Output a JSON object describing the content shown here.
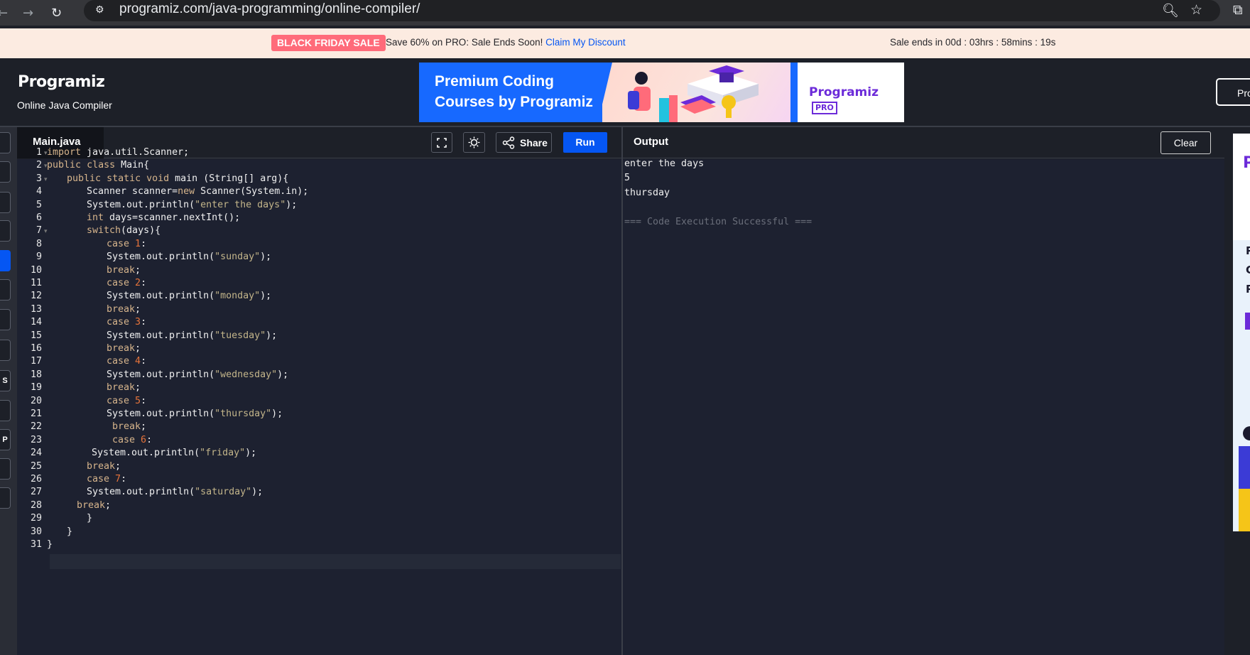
{
  "browser": {
    "url": "programiz.com/java-programming/online-compiler/"
  },
  "promo": {
    "badge": "BLACK FRIDAY SALE",
    "text": "Save 60% on PRO: Sale Ends Soon!",
    "link": "Claim My Discount",
    "timer": "Sale ends in 00d : 03hrs : 58mins : 19s"
  },
  "header": {
    "logo": "Programiz",
    "subtitle": "Online Java Compiler",
    "right_button": "Progr"
  },
  "ad": {
    "title": "Premium Coding Courses by Programiz",
    "brand": "Programiz",
    "brand_badge": "PRO"
  },
  "editor": {
    "tab": "Main.java",
    "share": "Share",
    "run": "Run",
    "lines": [
      {
        "n": "1",
        "fold": true,
        "indent": 0,
        "tokens": [
          {
            "t": "import",
            "c": "kw"
          },
          {
            "t": " java.util.Scanner;"
          }
        ]
      },
      {
        "n": "2",
        "fold": true,
        "indent": 0,
        "tokens": [
          {
            "t": "public",
            "c": "kw"
          },
          {
            "t": " "
          },
          {
            "t": "class",
            "c": "kw"
          },
          {
            "t": " Main{"
          }
        ]
      },
      {
        "n": "3",
        "fold": true,
        "indent": 4,
        "tokens": [
          {
            "t": "public",
            "c": "kw"
          },
          {
            "t": " "
          },
          {
            "t": "static",
            "c": "kw"
          },
          {
            "t": " "
          },
          {
            "t": "void",
            "c": "kw"
          },
          {
            "t": " main (String[] arg){"
          }
        ]
      },
      {
        "n": "4",
        "fold": false,
        "indent": 8,
        "tokens": [
          {
            "t": "Scanner scanner="
          },
          {
            "t": "new",
            "c": "kw"
          },
          {
            "t": " Scanner(System.in);"
          }
        ]
      },
      {
        "n": "5",
        "fold": false,
        "indent": 8,
        "tokens": [
          {
            "t": "System.out.println("
          },
          {
            "t": "\"enter the days\"",
            "c": "st"
          },
          {
            "t": ");"
          }
        ]
      },
      {
        "n": "6",
        "fold": false,
        "indent": 8,
        "tokens": [
          {
            "t": "int",
            "c": "kw"
          },
          {
            "t": " days=scanner.nextInt();"
          }
        ]
      },
      {
        "n": "7",
        "fold": true,
        "indent": 8,
        "tokens": [
          {
            "t": "switch",
            "c": "kw"
          },
          {
            "t": "(days){"
          }
        ]
      },
      {
        "n": "8",
        "fold": false,
        "indent": 12,
        "tokens": [
          {
            "t": "case",
            "c": "kw"
          },
          {
            "t": " "
          },
          {
            "t": "1",
            "c": "nm"
          },
          {
            "t": ":"
          }
        ]
      },
      {
        "n": "9",
        "fold": false,
        "indent": 12,
        "tokens": [
          {
            "t": "System.out.println("
          },
          {
            "t": "\"sunday\"",
            "c": "st"
          },
          {
            "t": ");"
          }
        ]
      },
      {
        "n": "10",
        "fold": false,
        "indent": 12,
        "tokens": [
          {
            "t": "break",
            "c": "kw"
          },
          {
            "t": ";"
          }
        ]
      },
      {
        "n": "11",
        "fold": false,
        "indent": 12,
        "tokens": [
          {
            "t": "case",
            "c": "kw"
          },
          {
            "t": " "
          },
          {
            "t": "2",
            "c": "nm"
          },
          {
            "t": ":"
          }
        ]
      },
      {
        "n": "12",
        "fold": false,
        "indent": 12,
        "tokens": [
          {
            "t": "System.out.println("
          },
          {
            "t": "\"monday\"",
            "c": "st"
          },
          {
            "t": ");"
          }
        ]
      },
      {
        "n": "13",
        "fold": false,
        "indent": 12,
        "tokens": [
          {
            "t": "break",
            "c": "kw"
          },
          {
            "t": ";"
          }
        ]
      },
      {
        "n": "14",
        "fold": false,
        "indent": 12,
        "tokens": [
          {
            "t": "case",
            "c": "kw"
          },
          {
            "t": " "
          },
          {
            "t": "3",
            "c": "nm"
          },
          {
            "t": ":"
          }
        ]
      },
      {
        "n": "15",
        "fold": false,
        "indent": 12,
        "tokens": [
          {
            "t": "System.out.println("
          },
          {
            "t": "\"tuesday\"",
            "c": "st"
          },
          {
            "t": ");"
          }
        ]
      },
      {
        "n": "16",
        "fold": false,
        "indent": 12,
        "tokens": [
          {
            "t": "break",
            "c": "kw"
          },
          {
            "t": ";"
          }
        ]
      },
      {
        "n": "17",
        "fold": false,
        "indent": 12,
        "tokens": [
          {
            "t": "case",
            "c": "kw"
          },
          {
            "t": " "
          },
          {
            "t": "4",
            "c": "nm"
          },
          {
            "t": ":"
          }
        ]
      },
      {
        "n": "18",
        "fold": false,
        "indent": 12,
        "tokens": [
          {
            "t": "System.out.println("
          },
          {
            "t": "\"wednesday\"",
            "c": "st"
          },
          {
            "t": ");"
          }
        ]
      },
      {
        "n": "19",
        "fold": false,
        "indent": 12,
        "tokens": [
          {
            "t": "break",
            "c": "kw"
          },
          {
            "t": ";"
          }
        ]
      },
      {
        "n": "20",
        "fold": false,
        "indent": 12,
        "tokens": [
          {
            "t": "case",
            "c": "kw"
          },
          {
            "t": " "
          },
          {
            "t": "5",
            "c": "nm"
          },
          {
            "t": ":"
          }
        ]
      },
      {
        "n": "21",
        "fold": false,
        "indent": 12,
        "tokens": [
          {
            "t": "System.out.println("
          },
          {
            "t": "\"thursday\"",
            "c": "st"
          },
          {
            "t": ");"
          }
        ]
      },
      {
        "n": "22",
        "fold": false,
        "indent": 13,
        "tokens": [
          {
            "t": "break",
            "c": "kw"
          },
          {
            "t": ";"
          }
        ]
      },
      {
        "n": "23",
        "fold": false,
        "indent": 13,
        "tokens": [
          {
            "t": "case",
            "c": "kw"
          },
          {
            "t": " "
          },
          {
            "t": "6",
            "c": "nm"
          },
          {
            "t": ":"
          }
        ]
      },
      {
        "n": "24",
        "fold": false,
        "indent": 9,
        "tokens": [
          {
            "t": "System.out.println("
          },
          {
            "t": "\"friday\"",
            "c": "st"
          },
          {
            "t": ");"
          }
        ]
      },
      {
        "n": "25",
        "fold": false,
        "indent": 8,
        "tokens": [
          {
            "t": "break",
            "c": "kw"
          },
          {
            "t": ";"
          }
        ]
      },
      {
        "n": "26",
        "fold": false,
        "indent": 8,
        "tokens": [
          {
            "t": "case",
            "c": "kw"
          },
          {
            "t": " "
          },
          {
            "t": "7",
            "c": "nm"
          },
          {
            "t": ":"
          }
        ]
      },
      {
        "n": "27",
        "fold": false,
        "indent": 8,
        "tokens": [
          {
            "t": "System.out.println("
          },
          {
            "t": "\"saturday\"",
            "c": "st"
          },
          {
            "t": ");"
          }
        ]
      },
      {
        "n": "28",
        "fold": false,
        "indent": 6,
        "tokens": [
          {
            "t": "break",
            "c": "kw"
          },
          {
            "t": ";"
          }
        ]
      },
      {
        "n": "29",
        "fold": false,
        "indent": 8,
        "tokens": [
          {
            "t": "}"
          }
        ]
      },
      {
        "n": "30",
        "fold": false,
        "indent": 4,
        "tokens": [
          {
            "t": "}"
          }
        ]
      },
      {
        "n": "31",
        "fold": false,
        "indent": 0,
        "tokens": [
          {
            "t": "}"
          }
        ]
      }
    ]
  },
  "output": {
    "title": "Output",
    "clear": "Clear",
    "lines": [
      "enter the days",
      "5",
      "thursday"
    ],
    "status": "=== Code Execution Successful ==="
  },
  "sidebar": {
    "items": [
      "",
      "",
      "",
      "",
      "",
      "",
      "",
      "",
      "S",
      "",
      "P",
      "",
      ""
    ]
  }
}
